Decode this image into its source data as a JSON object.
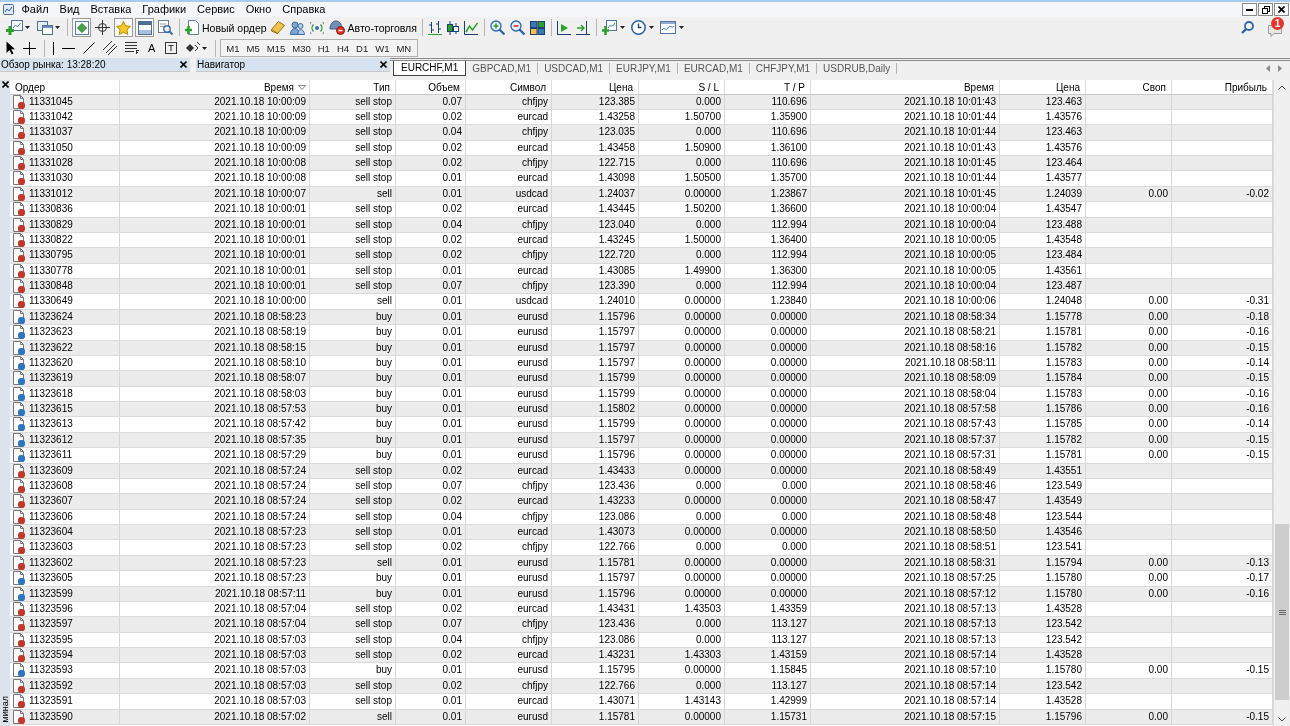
{
  "menu": [
    "Файл",
    "Вид",
    "Вставка",
    "Графики",
    "Сервис",
    "Окно",
    "Справка"
  ],
  "toolbar": {
    "toggles": [
      {
        "pressed": true
      },
      {
        "pressed": false
      },
      {
        "pressed": true
      },
      {
        "pressed": true
      },
      {
        "pressed": false
      }
    ],
    "new_order": "Новый ордер",
    "auto_trading": "Авто-торговля",
    "notification_count": "1"
  },
  "line_studies": {
    "text_tool": "A",
    "label_tool": "T",
    "timeframes": [
      "M1",
      "M5",
      "M15",
      "M30",
      "H1",
      "H4",
      "D1",
      "W1",
      "MN"
    ]
  },
  "panels": [
    {
      "title": "Обзор рынка: 13:28:20"
    },
    {
      "title": "Навигатор"
    }
  ],
  "chart_tabs": [
    {
      "label": "EURCHF,M1",
      "selected": true
    },
    {
      "label": "GBPCAD,M1",
      "selected": false
    },
    {
      "label": "USDCAD,M1",
      "selected": false
    },
    {
      "label": "EURJPY,M1",
      "selected": false
    },
    {
      "label": "EURCAD,M1",
      "selected": false
    },
    {
      "label": "CHFJPY,M1",
      "selected": false
    },
    {
      "label": "USDRUB,Daily",
      "selected": false
    }
  ],
  "terminal": {
    "side_label": "минал",
    "columns": [
      {
        "label": "Ордер",
        "sorted": false
      },
      {
        "label": "Время",
        "sorted": true
      },
      {
        "label": "Тип",
        "sorted": false
      },
      {
        "label": "Объем",
        "sorted": false
      },
      {
        "label": "Символ",
        "sorted": false
      },
      {
        "label": "Цена",
        "sorted": false
      },
      {
        "label": "S / L",
        "sorted": false
      },
      {
        "label": "T / P",
        "sorted": false
      },
      {
        "label": "Время",
        "sorted": false
      },
      {
        "label": "Цена",
        "sorted": false
      },
      {
        "label": "Своп",
        "sorted": false
      },
      {
        "label": "Прибыль",
        "sorted": false
      }
    ],
    "rows": [
      {
        "color": "#c0392b",
        "cells": [
          "11331045",
          "2021.10.18 10:00:09",
          "sell stop",
          "0.07",
          "chfjpy",
          "123.385",
          "0.000",
          "110.696",
          "2021.10.18 10:01:43",
          "123.463"
        ]
      },
      {
        "color": "#c0392b",
        "cells": [
          "11331042",
          "2021.10.18 10:00:09",
          "sell stop",
          "0.02",
          "eurcad",
          "1.43258",
          "1.50700",
          "1.35900",
          "2021.10.18 10:01:44",
          "1.43576"
        ]
      },
      {
        "color": "#c0392b",
        "cells": [
          "11331037",
          "2021.10.18 10:00:09",
          "sell stop",
          "0.04",
          "chfjpy",
          "123.035",
          "0.000",
          "110.696",
          "2021.10.18 10:01:44",
          "123.463"
        ]
      },
      {
        "color": "#c0392b",
        "cells": [
          "11331050",
          "2021.10.18 10:00:09",
          "sell stop",
          "0.02",
          "eurcad",
          "1.43458",
          "1.50900",
          "1.36100",
          "2021.10.18 10:01:43",
          "1.43576"
        ]
      },
      {
        "color": "#c0392b",
        "cells": [
          "11331028",
          "2021.10.18 10:00:08",
          "sell stop",
          "0.02",
          "chfjpy",
          "122.715",
          "0.000",
          "110.696",
          "2021.10.18 10:01:45",
          "123.464"
        ]
      },
      {
        "color": "#c0392b",
        "cells": [
          "11331030",
          "2021.10.18 10:00:08",
          "sell stop",
          "0.01",
          "eurcad",
          "1.43098",
          "1.50500",
          "1.35700",
          "2021.10.18 10:01:44",
          "1.43577"
        ]
      },
      {
        "color": "#c0392b",
        "cells": [
          "11331012",
          "2021.10.18 10:00:07",
          "sell",
          "0.01",
          "usdcad",
          "1.24037",
          "0.00000",
          "1.23867",
          "2021.10.18 10:01:45",
          "1.24039",
          "0.00",
          "-0.02"
        ]
      },
      {
        "color": "#c0392b",
        "cells": [
          "11330836",
          "2021.10.18 10:00:01",
          "sell stop",
          "0.02",
          "eurcad",
          "1.43445",
          "1.50200",
          "1.36600",
          "2021.10.18 10:00:04",
          "1.43547"
        ]
      },
      {
        "color": "#c0392b",
        "cells": [
          "11330829",
          "2021.10.18 10:00:01",
          "sell stop",
          "0.04",
          "chfjpy",
          "123.040",
          "0.000",
          "112.994",
          "2021.10.18 10:00:04",
          "123.488"
        ]
      },
      {
        "color": "#c0392b",
        "cells": [
          "11330822",
          "2021.10.18 10:00:01",
          "sell stop",
          "0.02",
          "eurcad",
          "1.43245",
          "1.50000",
          "1.36400",
          "2021.10.18 10:00:05",
          "1.43548"
        ]
      },
      {
        "color": "#c0392b",
        "cells": [
          "11330795",
          "2021.10.18 10:00:01",
          "sell stop",
          "0.02",
          "chfjpy",
          "122.720",
          "0.000",
          "112.994",
          "2021.10.18 10:00:05",
          "123.484"
        ]
      },
      {
        "color": "#c0392b",
        "cells": [
          "11330778",
          "2021.10.18 10:00:01",
          "sell stop",
          "0.01",
          "eurcad",
          "1.43085",
          "1.49900",
          "1.36300",
          "2021.10.18 10:00:05",
          "1.43561"
        ]
      },
      {
        "color": "#c0392b",
        "cells": [
          "11330848",
          "2021.10.18 10:00:01",
          "sell stop",
          "0.07",
          "chfjpy",
          "123.390",
          "0.000",
          "112.994",
          "2021.10.18 10:00:04",
          "123.487"
        ]
      },
      {
        "color": "#c0392b",
        "cells": [
          "11330649",
          "2021.10.18 10:00:00",
          "sell",
          "0.01",
          "usdcad",
          "1.24010",
          "0.00000",
          "1.23840",
          "2021.10.18 10:00:06",
          "1.24048",
          "0.00",
          "-0.31"
        ]
      },
      {
        "color": "#2f75c0",
        "cells": [
          "11323624",
          "2021.10.18 08:58:23",
          "buy",
          "0.01",
          "eurusd",
          "1.15796",
          "0.00000",
          "0.00000",
          "2021.10.18 08:58:34",
          "1.15778",
          "0.00",
          "-0.18"
        ]
      },
      {
        "color": "#2f75c0",
        "cells": [
          "11323623",
          "2021.10.18 08:58:19",
          "buy",
          "0.01",
          "eurusd",
          "1.15797",
          "0.00000",
          "0.00000",
          "2021.10.18 08:58:21",
          "1.15781",
          "0.00",
          "-0.16"
        ]
      },
      {
        "color": "#2f75c0",
        "cells": [
          "11323622",
          "2021.10.18 08:58:15",
          "buy",
          "0.01",
          "eurusd",
          "1.15797",
          "0.00000",
          "0.00000",
          "2021.10.18 08:58:16",
          "1.15782",
          "0.00",
          "-0.15"
        ]
      },
      {
        "color": "#2f75c0",
        "cells": [
          "11323620",
          "2021.10.18 08:58:10",
          "buy",
          "0.01",
          "eurusd",
          "1.15797",
          "0.00000",
          "0.00000",
          "2021.10.18 08:58:11",
          "1.15783",
          "0.00",
          "-0.14"
        ]
      },
      {
        "color": "#2f75c0",
        "cells": [
          "11323619",
          "2021.10.18 08:58:07",
          "buy",
          "0.01",
          "eurusd",
          "1.15799",
          "0.00000",
          "0.00000",
          "2021.10.18 08:58:09",
          "1.15784",
          "0.00",
          "-0.15"
        ]
      },
      {
        "color": "#2f75c0",
        "cells": [
          "11323618",
          "2021.10.18 08:58:03",
          "buy",
          "0.01",
          "eurusd",
          "1.15799",
          "0.00000",
          "0.00000",
          "2021.10.18 08:58:04",
          "1.15783",
          "0.00",
          "-0.16"
        ]
      },
      {
        "color": "#2f75c0",
        "cells": [
          "11323615",
          "2021.10.18 08:57:53",
          "buy",
          "0.01",
          "eurusd",
          "1.15802",
          "0.00000",
          "0.00000",
          "2021.10.18 08:57:58",
          "1.15786",
          "0.00",
          "-0.16"
        ]
      },
      {
        "color": "#2f75c0",
        "cells": [
          "11323613",
          "2021.10.18 08:57:42",
          "buy",
          "0.01",
          "eurusd",
          "1.15799",
          "0.00000",
          "0.00000",
          "2021.10.18 08:57:43",
          "1.15785",
          "0.00",
          "-0.14"
        ]
      },
      {
        "color": "#2f75c0",
        "cells": [
          "11323612",
          "2021.10.18 08:57:35",
          "buy",
          "0.01",
          "eurusd",
          "1.15797",
          "0.00000",
          "0.00000",
          "2021.10.18 08:57:37",
          "1.15782",
          "0.00",
          "-0.15"
        ]
      },
      {
        "color": "#2f75c0",
        "cells": [
          "11323611",
          "2021.10.18 08:57:29",
          "buy",
          "0.01",
          "eurusd",
          "1.15796",
          "0.00000",
          "0.00000",
          "2021.10.18 08:57:31",
          "1.15781",
          "0.00",
          "-0.15"
        ]
      },
      {
        "color": "#c0392b",
        "cells": [
          "11323609",
          "2021.10.18 08:57:24",
          "sell stop",
          "0.02",
          "eurcad",
          "1.43433",
          "0.00000",
          "0.00000",
          "2021.10.18 08:58:49",
          "1.43551"
        ]
      },
      {
        "color": "#c0392b",
        "cells": [
          "11323608",
          "2021.10.18 08:57:24",
          "sell stop",
          "0.07",
          "chfjpy",
          "123.436",
          "0.000",
          "0.000",
          "2021.10.18 08:58:46",
          "123.549"
        ]
      },
      {
        "color": "#c0392b",
        "cells": [
          "11323607",
          "2021.10.18 08:57:24",
          "sell stop",
          "0.02",
          "eurcad",
          "1.43233",
          "0.00000",
          "0.00000",
          "2021.10.18 08:58:47",
          "1.43549"
        ]
      },
      {
        "color": "#c0392b",
        "cells": [
          "11323606",
          "2021.10.18 08:57:24",
          "sell stop",
          "0.04",
          "chfjpy",
          "123.086",
          "0.000",
          "0.000",
          "2021.10.18 08:58:48",
          "123.544"
        ]
      },
      {
        "color": "#c0392b",
        "cells": [
          "11323604",
          "2021.10.18 08:57:23",
          "sell stop",
          "0.01",
          "eurcad",
          "1.43073",
          "0.00000",
          "0.00000",
          "2021.10.18 08:58:50",
          "1.43546"
        ]
      },
      {
        "color": "#c0392b",
        "cells": [
          "11323603",
          "2021.10.18 08:57:23",
          "sell stop",
          "0.02",
          "chfjpy",
          "122.766",
          "0.000",
          "0.000",
          "2021.10.18 08:58:51",
          "123.541"
        ]
      },
      {
        "color": "#c0392b",
        "cells": [
          "11323602",
          "2021.10.18 08:57:23",
          "sell",
          "0.01",
          "eurusd",
          "1.15781",
          "0.00000",
          "0.00000",
          "2021.10.18 08:58:31",
          "1.15794",
          "0.00",
          "-0.13"
        ]
      },
      {
        "color": "#2f75c0",
        "cells": [
          "11323605",
          "2021.10.18 08:57:23",
          "buy",
          "0.01",
          "eurusd",
          "1.15797",
          "0.00000",
          "0.00000",
          "2021.10.18 08:57:25",
          "1.15780",
          "0.00",
          "-0.17"
        ]
      },
      {
        "color": "#2f75c0",
        "cells": [
          "11323599",
          "2021.10.18 08:57:11",
          "buy",
          "0.01",
          "eurusd",
          "1.15796",
          "0.00000",
          "0.00000",
          "2021.10.18 08:57:12",
          "1.15780",
          "0.00",
          "-0.16"
        ]
      },
      {
        "color": "#c0392b",
        "cells": [
          "11323596",
          "2021.10.18 08:57:04",
          "sell stop",
          "0.02",
          "eurcad",
          "1.43431",
          "1.43503",
          "1.43359",
          "2021.10.18 08:57:13",
          "1.43528"
        ]
      },
      {
        "color": "#c0392b",
        "cells": [
          "11323597",
          "2021.10.18 08:57:04",
          "sell stop",
          "0.07",
          "chfjpy",
          "123.436",
          "0.000",
          "113.127",
          "2021.10.18 08:57:13",
          "123.542"
        ]
      },
      {
        "color": "#c0392b",
        "cells": [
          "11323595",
          "2021.10.18 08:57:03",
          "sell stop",
          "0.04",
          "chfjpy",
          "123.086",
          "0.000",
          "113.127",
          "2021.10.18 08:57:13",
          "123.542"
        ]
      },
      {
        "color": "#c0392b",
        "cells": [
          "11323594",
          "2021.10.18 08:57:03",
          "sell stop",
          "0.02",
          "eurcad",
          "1.43231",
          "1.43303",
          "1.43159",
          "2021.10.18 08:57:14",
          "1.43528"
        ]
      },
      {
        "color": "#2f75c0",
        "cells": [
          "11323593",
          "2021.10.18 08:57:03",
          "buy",
          "0.01",
          "eurusd",
          "1.15795",
          "0.00000",
          "1.15845",
          "2021.10.18 08:57:10",
          "1.15780",
          "0.00",
          "-0.15"
        ]
      },
      {
        "color": "#c0392b",
        "cells": [
          "11323592",
          "2021.10.18 08:57:03",
          "sell stop",
          "0.02",
          "chfjpy",
          "122.766",
          "0.000",
          "113.127",
          "2021.10.18 08:57:14",
          "123.542"
        ]
      },
      {
        "color": "#c0392b",
        "cells": [
          "11323591",
          "2021.10.18 08:57:03",
          "sell stop",
          "0.01",
          "eurcad",
          "1.43071",
          "1.43143",
          "1.42999",
          "2021.10.18 08:57:14",
          "1.43528"
        ]
      },
      {
        "color": "#c0392b",
        "cells": [
          "11323590",
          "2021.10.18 08:57:02",
          "sell",
          "0.01",
          "eurusd",
          "1.15781",
          "0.00000",
          "1.15731",
          "2021.10.18 08:57:15",
          "1.15796",
          "0.00",
          "-0.15"
        ]
      }
    ]
  }
}
